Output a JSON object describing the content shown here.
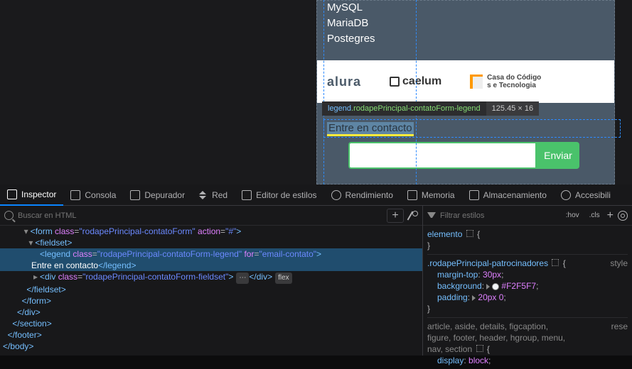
{
  "viewport": {
    "tech_list": [
      "MySQL",
      "MariaDB",
      "Postegres"
    ],
    "sponsors": {
      "s1": "alura",
      "s2": "caelum",
      "s3a": "Casa do Código",
      "s3b": "s e Tecnologia"
    },
    "legend_text": "Entre en contacto",
    "submit": "Enviar"
  },
  "tooltip": {
    "tag": "legend",
    "cls": ".rodapePrincipal-contatoForm-legend",
    "dims": "125.45 × 16"
  },
  "tabs": {
    "inspector": "Inspector",
    "consola": "Consola",
    "depurador": "Depurador",
    "red": "Red",
    "editor": "Editor de estilos",
    "rendimiento": "Rendimiento",
    "memoria": "Memoria",
    "almacenamiento": "Almacenamiento",
    "accesib": "Accesibili"
  },
  "search": {
    "placeholder": "Buscar en HTML"
  },
  "dom": {
    "l1": {
      "ind": "        ",
      "tw": "▾",
      "t": "form",
      "a1": "class",
      "v1": "rodapePrincipal-contatoForm",
      "a2": "action",
      "v2": "#"
    },
    "l2": {
      "ind": "          ",
      "tw": "▾",
      "t": "fieldset"
    },
    "l3": {
      "ind": "            ",
      "t": "legend",
      "a1": "class",
      "v1": "rodapePrincipal-contatoForm-legend",
      "a2": "for",
      "v2": "email-contato"
    },
    "l3b": {
      "ind": "            ",
      "txt": "Entre en contacto",
      "ct": "legend"
    },
    "l4": {
      "ind": "            ",
      "tw": "▸",
      "t": "div",
      "a1": "class",
      "v1": "rodapePrincipal-contatoForm-fieldset",
      "dots": "⋯",
      "ct": "div",
      "badge": "flex"
    },
    "l5": {
      "ind": "          ",
      "ct": "fieldset"
    },
    "l6": {
      "ind": "        ",
      "ct": "form"
    },
    "l7": {
      "ind": "      ",
      "ct": "div"
    },
    "l8": {
      "ind": "    ",
      "ct": "section"
    },
    "l9": {
      "ind": "  ",
      "ct": "footer"
    },
    "l10": {
      "ind": "",
      "ct": "body"
    }
  },
  "styles": {
    "filter": "Filtrar estilos",
    "hov": ":hov",
    "cls": ".cls",
    "r1": {
      "sel": "elemento",
      "br": "{",
      "cb": "}"
    },
    "r2": {
      "sel": ".rodapePrincipal-patrocinadores",
      "inh": "style",
      "p1": "margin-top",
      "v1": "30px",
      "p2": "background",
      "v2": "#F2F5F7",
      "p3": "padding",
      "v3": "20px 0"
    },
    "r3": {
      "sel": "article, aside, details, figcaption,",
      "sel2": "figure, footer, header, hgroup, menu,",
      "sel3": "nav, section",
      "inh": "rese",
      "p1": "display",
      "v1": "block"
    }
  }
}
